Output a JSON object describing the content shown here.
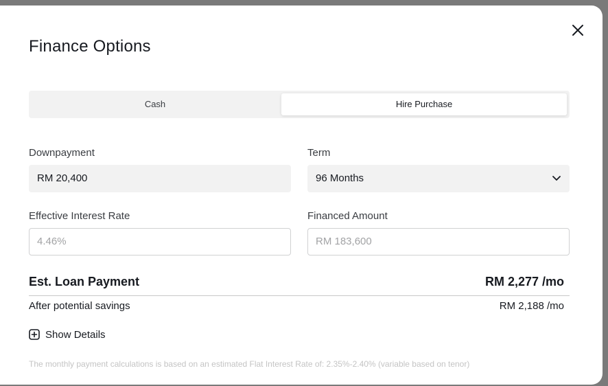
{
  "modal": {
    "title": "Finance Options",
    "close_icon": "close-icon"
  },
  "payment_tabs": [
    {
      "label": "Cash",
      "selected": false
    },
    {
      "label": "Hire Purchase",
      "selected": true
    }
  ],
  "form": {
    "downpayment": {
      "label": "Downpayment",
      "value": "RM 20,400"
    },
    "term": {
      "label": "Term",
      "value": "96 Months",
      "icon": "chevron-down-icon"
    },
    "interest_rate": {
      "label": "Effective Interest Rate",
      "placeholder": "4.46%"
    },
    "financed_amount": {
      "label": "Financed Amount",
      "placeholder": "RM 183,600"
    }
  },
  "summary": {
    "est_label": "Est. Loan Payment",
    "est_value": "RM 2,277 /mo",
    "after_label": "After potential savings",
    "after_value": "RM 2,188 /mo"
  },
  "details": {
    "label": "Show Details",
    "icon": "plus-box-icon"
  },
  "disclaimer": "The monthly payment calculations is based on an estimated Flat Interest Rate of: 2.35%-2.40% (variable based on tenor)",
  "colors": {
    "text": "#171a20",
    "field_bg": "#f2f2f2",
    "muted": "#a2a3a5",
    "overlay": "#7a7a7a"
  }
}
